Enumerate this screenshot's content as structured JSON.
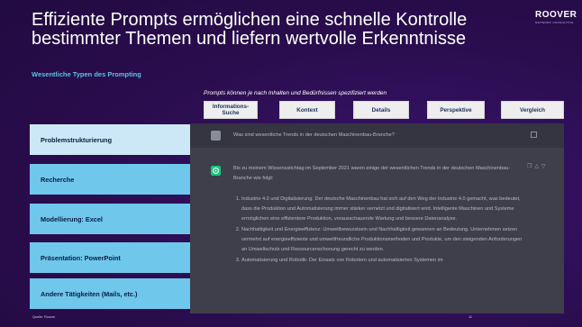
{
  "title": {
    "line1": "Effiziente Prompts ermöglichen eine schnelle Kontrolle",
    "line2": "bestimmter Themen und liefern wertvolle Erkenntnisse"
  },
  "logo": {
    "brand": "ROOVER",
    "sub": "NETWORK CONSULTING"
  },
  "subtitle": "Wesentliche Typen des Prompting",
  "caption": "Prompts können je nach Inhalten und Bedürfnissen spezifiziert werden",
  "tabs": [
    "Informations-Suche",
    "Kontext",
    "Details",
    "Perspektive",
    "Vergleich"
  ],
  "sidebar": [
    "Problemstrukturierung",
    "Recherche",
    "Modellierung: Excel",
    "Präsentation: PowerPoint",
    "Andere Tätigkeiten (Mails, etc.)"
  ],
  "chat": {
    "question": "Was sind wesentliche Trends in der deutschen Maschinenbau-Branche?",
    "intro": "Bis zu meinem Wissensstichtag im September 2021 waren einige der wesentlichen Trends in der deutschen Maschinenbau-Branche wie folgt:",
    "points": [
      "Industrie 4.0 und Digitalisierung: Der deutsche Maschinenbau hat sich auf den Weg der Industrie 4.0 gemacht, was bedeutet, dass die Produktion und Automatisierung immer stärker vernetzt und digitalisiert wird. Intelligente Maschinen und Systeme ermöglichen eine effizientere Produktion, vorausschauende Wartung und bessere Datenanalyse.",
      "Nachhaltigkeit und Energieeffizienz: Umweltbewusstsein und Nachhaltigkeit gewannen an Bedeutung. Unternehmen setzen vermehrt auf energieeffiziente und umweltfreundliche Produktionsmethoden und Produkte, um den steigenden Anforderungen an Umweltschutz und Ressourcenschonung gerecht zu werden.",
      "Automatisierung und Robotik: Der Einsatz von Robotern und automatisierten Systemen im"
    ]
  },
  "footer": {
    "source": "Quelle: Roover",
    "page": "11"
  },
  "colors": {
    "background": "#2a0d4e",
    "accent": "#5fc1e6",
    "sidebar": "#6fc7ec",
    "sidebar_active": "#cce8f7",
    "chat_bg": "#3e3f4b"
  }
}
